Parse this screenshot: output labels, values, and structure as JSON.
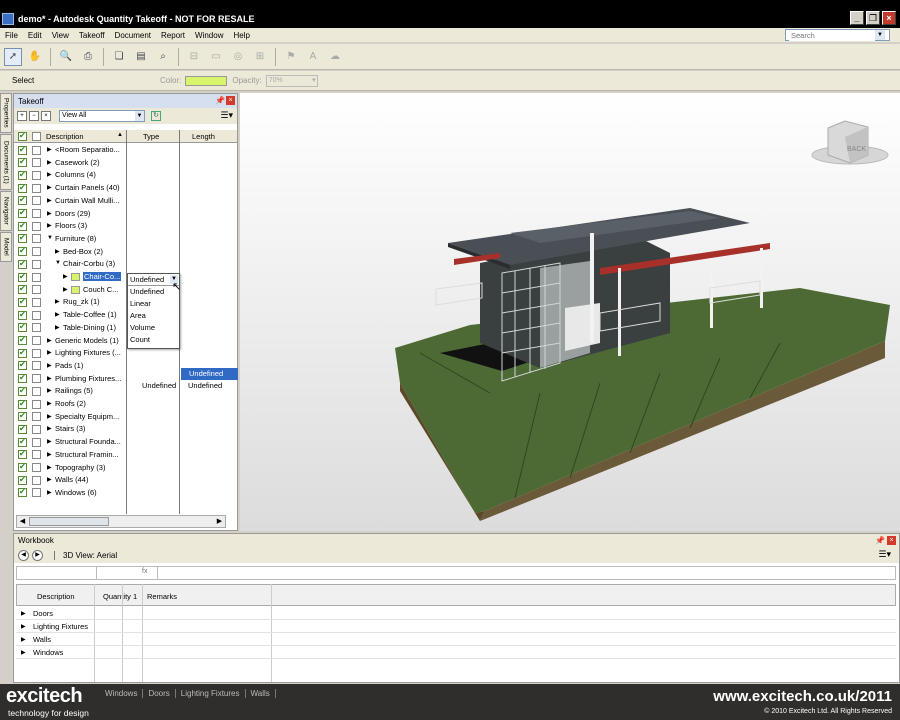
{
  "window": {
    "title": "demo* - Autodesk Quantity Takeoff - NOT FOR RESALE"
  },
  "menubar": {
    "items": [
      "File",
      "Edit",
      "View",
      "Takeoff",
      "Document",
      "Report",
      "Window",
      "Help"
    ],
    "search_placeholder": "Search"
  },
  "propbar": {
    "select_label": "Select",
    "color_label": "Color:",
    "opacity_label": "Opacity:",
    "opacity_value": "70%",
    "color_swatch": "#d8f46a"
  },
  "sidetabs": [
    "Properties",
    "Documents (1)",
    "Navigator",
    "Model"
  ],
  "takeoff": {
    "title": "Takeoff",
    "view_filter": "View All",
    "columns": [
      "Description",
      "Type",
      "Length"
    ],
    "rows": [
      {
        "label": "<Room Separatio...",
        "indent": 0
      },
      {
        "label": "Casework (2)",
        "indent": 0
      },
      {
        "label": "Columns (4)",
        "indent": 0
      },
      {
        "label": "Curtain Panels (40)",
        "indent": 0
      },
      {
        "label": "Curtain Wall Mulli...",
        "indent": 0
      },
      {
        "label": "Doors (29)",
        "indent": 0
      },
      {
        "label": "Floors (3)",
        "indent": 0
      },
      {
        "label": "Furniture (8)",
        "indent": 0
      },
      {
        "label": "Bed-Box (2)",
        "indent": 1
      },
      {
        "label": "Chair-Corbu (3)",
        "indent": 1
      },
      {
        "label": "Chair-Co...",
        "indent": 2
      },
      {
        "label": "Couch C...",
        "indent": 2
      },
      {
        "label": "Rug_zk (1)",
        "indent": 1
      },
      {
        "label": "Table-Coffee (1)",
        "indent": 1
      },
      {
        "label": "Table-Dining (1)",
        "indent": 1
      },
      {
        "label": "Generic Models (1)",
        "indent": 0
      },
      {
        "label": "Lighting Fixtures (...",
        "indent": 0
      },
      {
        "label": "Pads (1)",
        "indent": 0
      },
      {
        "label": "Plumbing Fixtures...",
        "indent": 0
      },
      {
        "label": "Railings (5)",
        "indent": 0
      },
      {
        "label": "Roofs (2)",
        "indent": 0
      },
      {
        "label": "Specialty Equipm...",
        "indent": 0
      },
      {
        "label": "Stairs (3)",
        "indent": 0
      },
      {
        "label": "Structural Founda...",
        "indent": 0
      },
      {
        "label": "Structural Framin...",
        "indent": 0
      },
      {
        "label": "Topography (3)",
        "indent": 0
      },
      {
        "label": "Walls (44)",
        "indent": 0
      },
      {
        "label": "Windows (6)",
        "indent": 0
      }
    ],
    "type_cells": {
      "chair": "Undefined",
      "couch": "Undefined",
      "length_selected": "Undefined",
      "length_couch": "Undefined"
    },
    "type_dropdown": {
      "current": "Undefined",
      "options": [
        "Undefined",
        "Linear",
        "Area",
        "Volume",
        "Count"
      ]
    }
  },
  "viewcube": {
    "face_label": "BACK"
  },
  "workbook": {
    "title": "Workbook",
    "view_label": "3D View: Aerial",
    "columns": [
      "Description",
      "Quantity 1",
      "Remarks"
    ],
    "rows": [
      "Doors",
      "Lighting Fixtures",
      "Walls",
      "Windows"
    ],
    "fx": "fx"
  },
  "bottom_tabs": [
    "Windows",
    "Doors",
    "Lighting Fixtures",
    "Walls"
  ],
  "branding": {
    "logo": "excitech",
    "tagline": "technology for design",
    "url": "www.excitech.co.uk/2011",
    "copyright": "© 2010 Excitech Ltd. All Rights Reserved"
  }
}
